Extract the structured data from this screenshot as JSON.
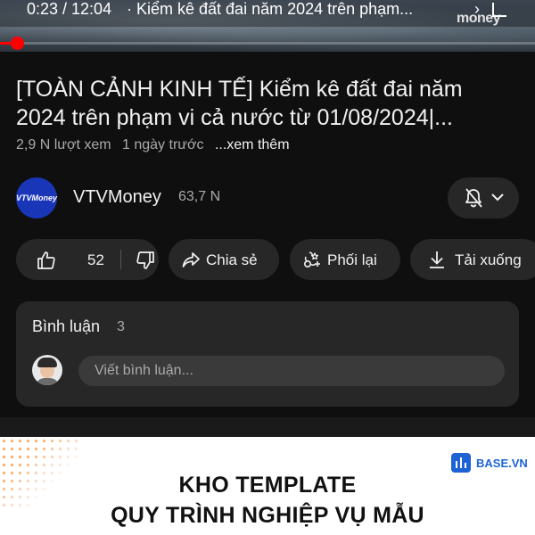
{
  "player": {
    "time": "0:23 / 12:04",
    "title": "· Kiểm kê đất đai năm 2024 trên phạm...",
    "watermark": "money",
    "progress_fraction": 0.032,
    "colors": {
      "progress": "#ff0000"
    }
  },
  "video": {
    "title": "[TOÀN CẢNH KINH TẾ] Kiểm kê đất đai năm 2024 trên phạm vi cả nước từ 01/08/2024|...",
    "views": "2,9 N lượt xem",
    "age": "1 ngày trước",
    "more": "...xem thêm"
  },
  "channel": {
    "avatar_text": "VTVMoney",
    "name": "VTVMoney",
    "subscribers": "63,7 N",
    "bell_icon": "bell-off-icon",
    "brand_color": "#1a36b8"
  },
  "actions": {
    "like_count": "52",
    "share": "Chia sẻ",
    "remix": "Phối lại",
    "download": "Tải xuống"
  },
  "comments": {
    "title": "Bình luận",
    "count": "3",
    "placeholder": "Viết bình luận..."
  },
  "ad": {
    "brand": "BASE.VN",
    "line1": "KHO TEMPLATE",
    "line2": "QUY TRÌNH NGHIỆP VỤ MẪU",
    "brand_color": "#1d63d6"
  }
}
